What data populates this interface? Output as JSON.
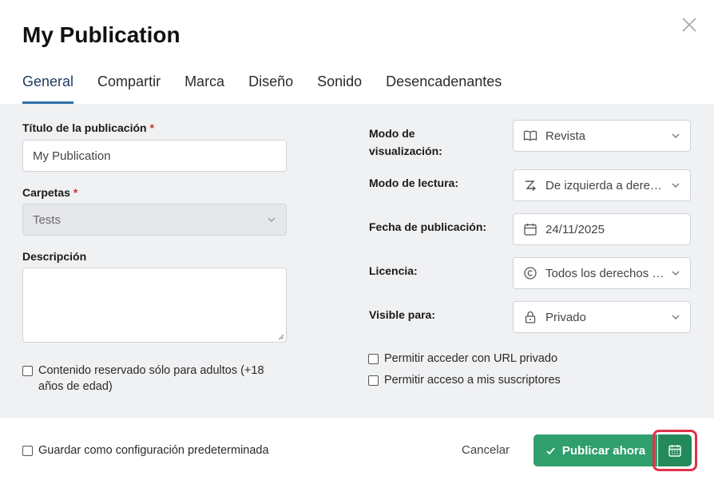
{
  "dialog": {
    "title": "My Publication",
    "tabs": [
      {
        "label": "General",
        "active": true
      },
      {
        "label": "Compartir"
      },
      {
        "label": "Marca"
      },
      {
        "label": "Diseño"
      },
      {
        "label": "Sonido"
      },
      {
        "label": "Desencadenantes"
      }
    ]
  },
  "left": {
    "title_label": "Título de la publicación",
    "title_value": "My Publication",
    "folders_label": "Carpetas",
    "folders_value": "Tests",
    "description_label": "Descripción",
    "description_value": "",
    "adult_label_line1": "Contenido reservado sólo para adultos (+18",
    "adult_label_line2": "años de edad)",
    "required_mark": "*"
  },
  "right": {
    "view_mode_label_line1": "Modo de",
    "view_mode_label_line2": "visualización:",
    "view_mode_value": "Revista",
    "reading_mode_label": "Modo de lectura:",
    "reading_mode_value": "De izquierda a derecha",
    "date_label": "Fecha de publicación:",
    "date_value": "24/11/2025",
    "license_label": "Licencia:",
    "license_value": "Todos los derechos reservados",
    "visible_label": "Visible para:",
    "visible_value": "Privado",
    "private_url_label": "Permitir acceder con URL privado",
    "subscribers_label": "Permitir acceso a mis suscriptores"
  },
  "footer": {
    "save_default_label": "Guardar como configuración predeterminada",
    "cancel_label": "Cancelar",
    "publish_label": "Publicar ahora"
  },
  "icons": {
    "close": "close-icon",
    "book": "book-icon",
    "reading_direction": "reading-direction-icon",
    "calendar": "calendar-icon",
    "copyright": "copyright-icon",
    "lock": "lock-icon",
    "check": "check-icon",
    "schedule": "calendar-icon"
  },
  "colors": {
    "accent_tab": "#2f6fa7",
    "publish_green": "#2f9f6c",
    "schedule_green": "#248a5c",
    "highlight_red": "#e0324a",
    "required_red": "#d0342c",
    "panel_bg": "#f0f1f3"
  }
}
